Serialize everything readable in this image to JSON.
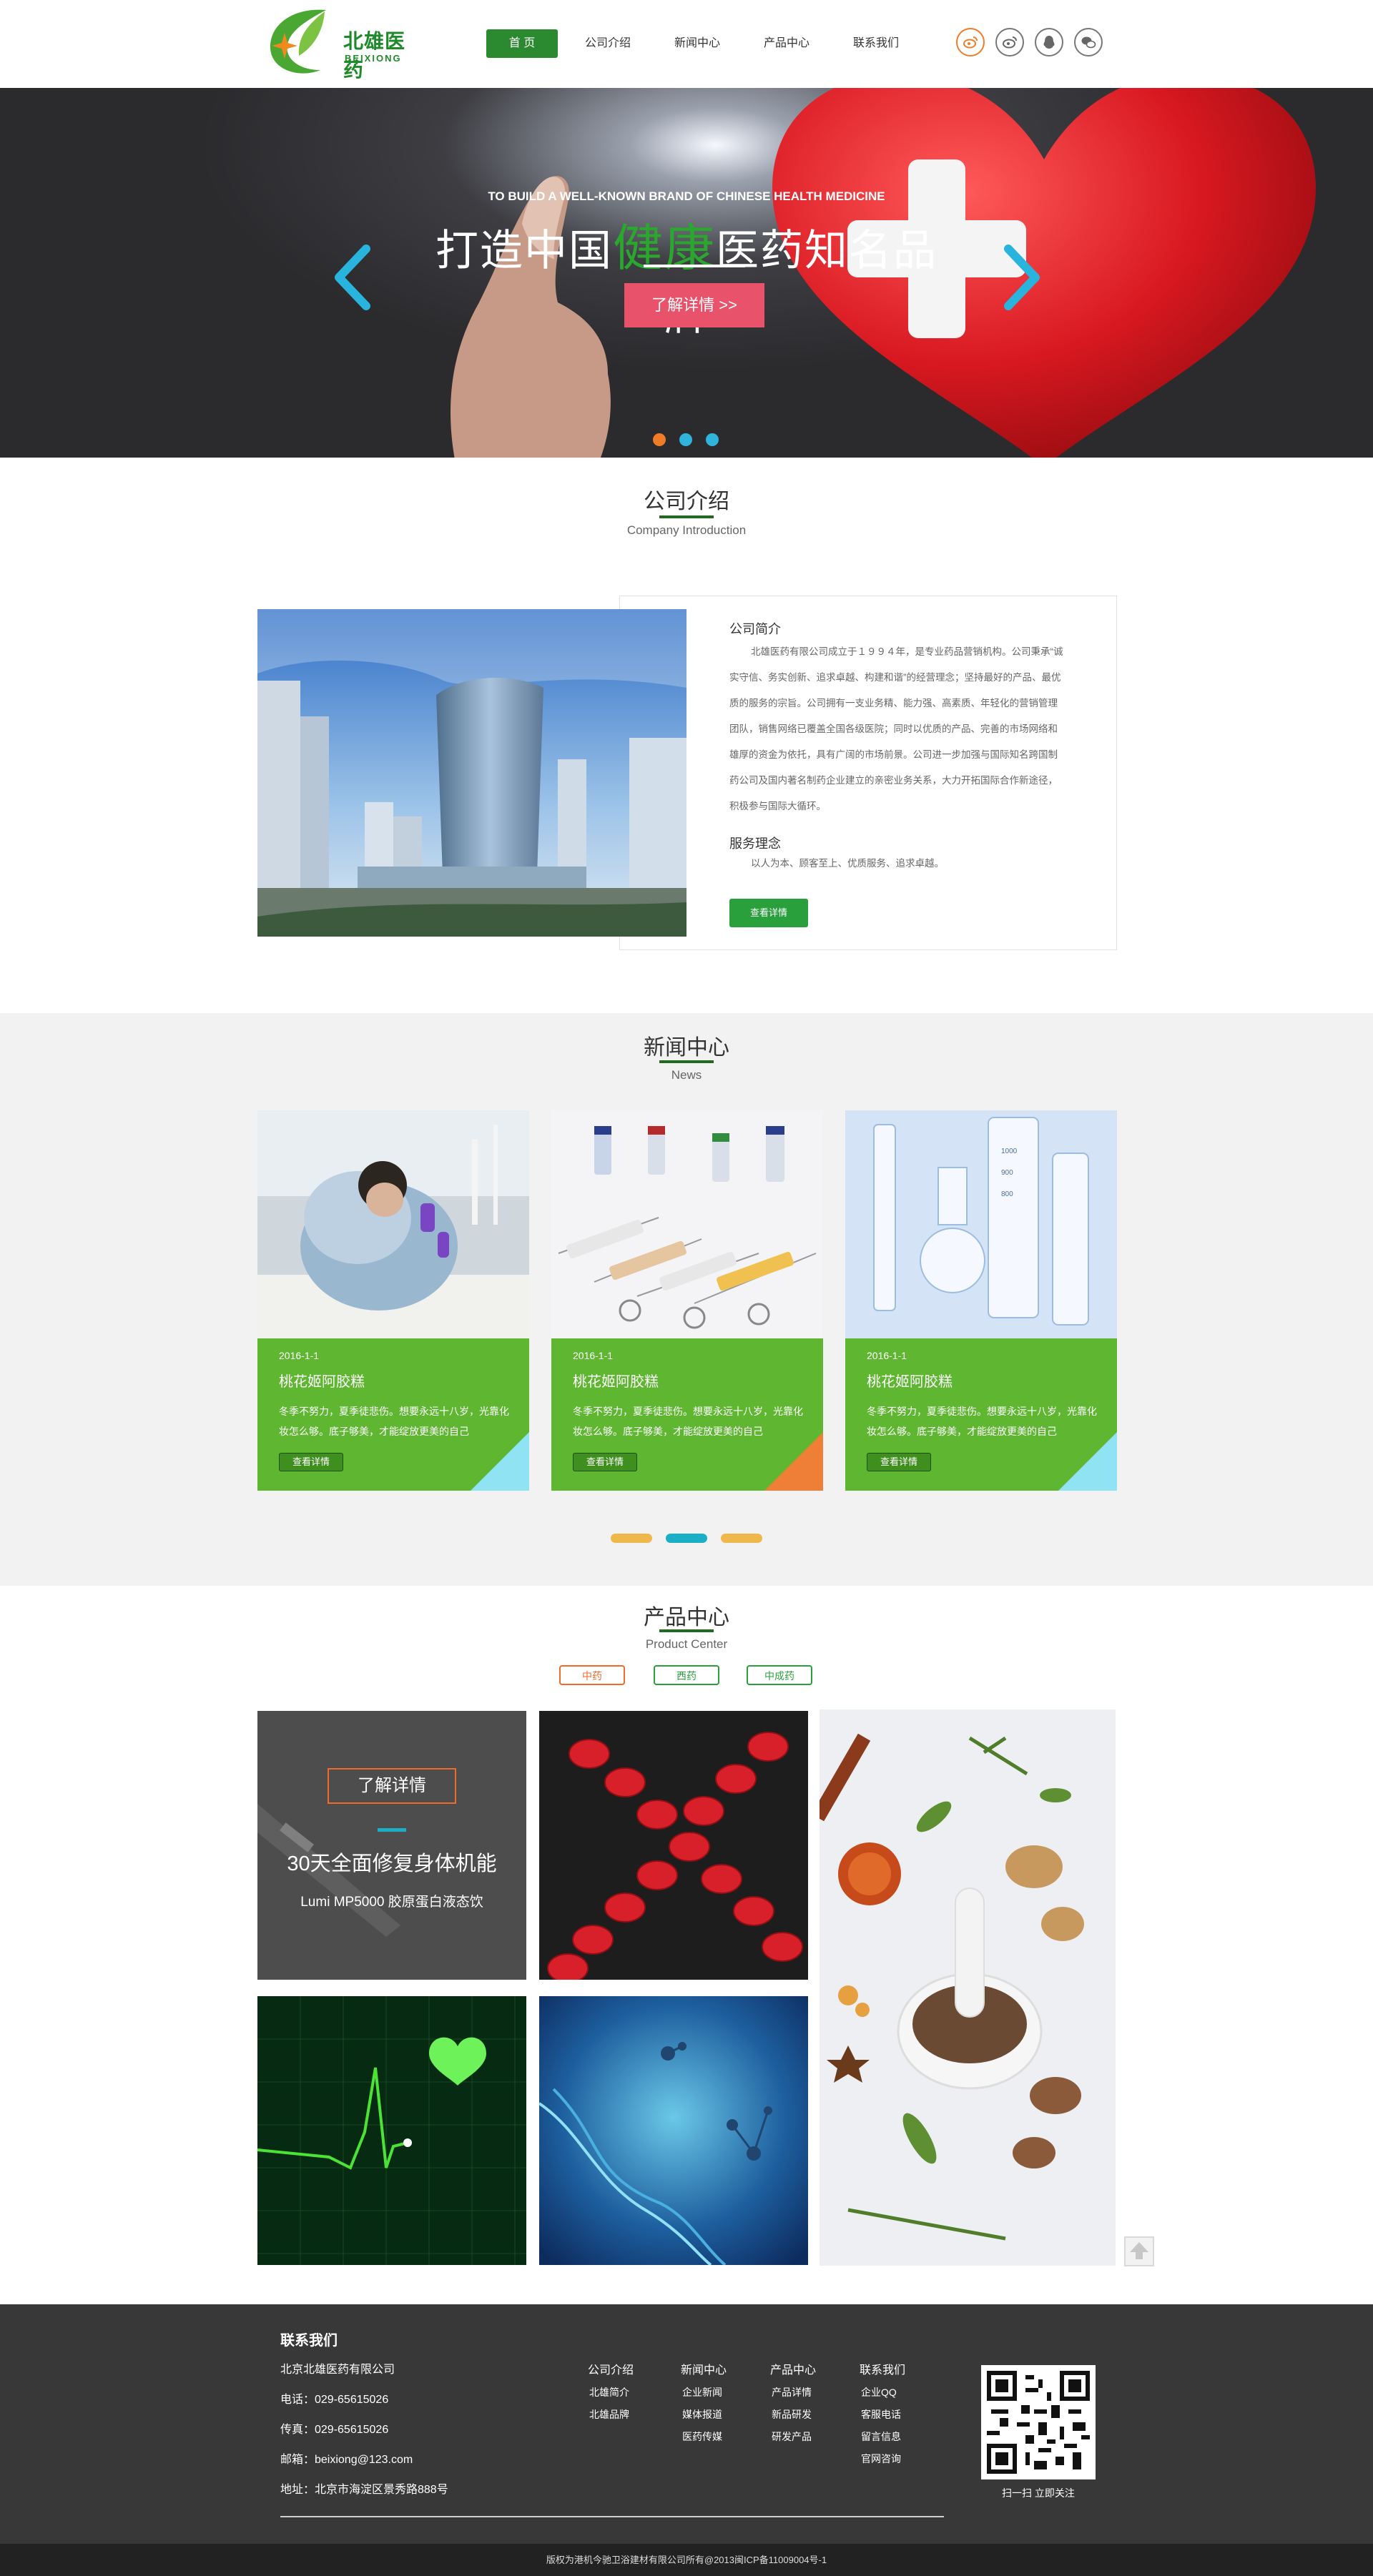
{
  "header": {
    "brand_cn": "北雄医药",
    "brand_en": "BEIXIONG",
    "nav": [
      {
        "label": "首 页",
        "active": true
      },
      {
        "label": "公司介绍"
      },
      {
        "label": "新闻中心"
      },
      {
        "label": "产品中心"
      },
      {
        "label": "联系我们"
      }
    ],
    "social_icons": [
      "weibo-icon",
      "tencent-weibo-icon",
      "qq-icon",
      "wechat-icon"
    ]
  },
  "banner": {
    "en": "TO BUILD A WELL-KNOWN BRAND OF CHINESE HEALTH MEDICINE",
    "cn_before": "打造中国",
    "cn_highlight": "健康",
    "cn_after": "医药知名品牌",
    "button": "了解详情 >>",
    "dots_colors": [
      "#f07c28",
      "#2fb5dc",
      "#2fb5dc"
    ]
  },
  "company": {
    "title": "公司介绍",
    "subtitle": "Company Introduction",
    "heading1": "公司简介",
    "text1": "北雄医药有限公司成立于１９９４年，是专业药品营销机构。公司秉承“诚实守信、务实创新、追求卓越、构建和谐”的经营理念；坚持最好的产品、最优质的服务的宗旨。公司拥有一支业务精、能力强、高素质、年轻化的营销管理团队，销售网络已覆盖全国各级医院；同时以优质的产品、完善的市场网络和雄厚的资金为依托，具有广阔的市场前景。公司进一步加强与国际知名跨国制药公司及国内著名制药企业建立的亲密业务关系，大力开拓国际合作新途径，积极参与国际大循环。",
    "heading2": "服务理念",
    "text2": "以人为本、顾客至上、优质服务、追求卓越。",
    "button": "查看详情"
  },
  "news": {
    "title": "新闻中心",
    "subtitle": "News",
    "cards": [
      {
        "date": "2016-1-1",
        "title": "桃花姬阿胶糕",
        "desc": "冬季不努力，夏季徒悲伤。想要永远十八岁，光靠化妆怎么够。底子够美，才能绽放更美的自己",
        "more": "查看详情",
        "corner": "#8fe3f2"
      },
      {
        "date": "2016-1-1",
        "title": "桃花姬阿胶糕",
        "desc": "冬季不努力，夏季徒悲伤。想要永远十八岁，光靠化妆怎么够。底子够美，才能绽放更美的自己",
        "more": "查看详情",
        "corner": "#ef7f36"
      },
      {
        "date": "2016-1-1",
        "title": "桃花姬阿胶糕",
        "desc": "冬季不努力，夏季徒悲伤。想要永远十八岁，光靠化妆怎么够。底子够美，才能绽放更美的自己",
        "more": "查看详情",
        "corner": "#8fe3f2"
      }
    ],
    "pager_colors": [
      "#efb84b",
      "#1bafc7",
      "#efb84b"
    ]
  },
  "products": {
    "title": "产品中心",
    "subtitle": "Product Center",
    "tabs": [
      {
        "label": "中药",
        "color": "#ef6b2c"
      },
      {
        "label": "西药",
        "color": "#2aa03d"
      },
      {
        "label": "中成药",
        "color": "#2aa03d"
      }
    ],
    "feature_button": "了解详情",
    "feature_title": "30天全面修复身体机能",
    "feature_sub": "Lumi MP5000 胶原蛋白液态饮"
  },
  "footer": {
    "contact_title": "联系我们",
    "company": "北京北雄医药有限公司",
    "phone": "电话：029-65615026",
    "fax": "传真：029-65615026",
    "email": "邮箱：beixiong@123.com",
    "address": "地址：北京市海淀区景秀路888号",
    "columns": [
      {
        "head": "公司介绍",
        "links": [
          "北雄简介",
          "北雄品牌"
        ]
      },
      {
        "head": "新闻中心",
        "links": [
          "企业新闻",
          "媒体报道",
          "医药传媒"
        ]
      },
      {
        "head": "产品中心",
        "links": [
          "产品详情",
          "新品研发",
          "研发产品"
        ]
      },
      {
        "head": "联系我们",
        "links": [
          "企业QQ",
          "客服电话",
          "留言信息",
          "官网咨询"
        ]
      }
    ],
    "qr_caption": "扫一扫 立即关注",
    "copyright": "版权为港机今驰卫浴建材有限公司所有@2013闽ICP备11009004号-1"
  }
}
